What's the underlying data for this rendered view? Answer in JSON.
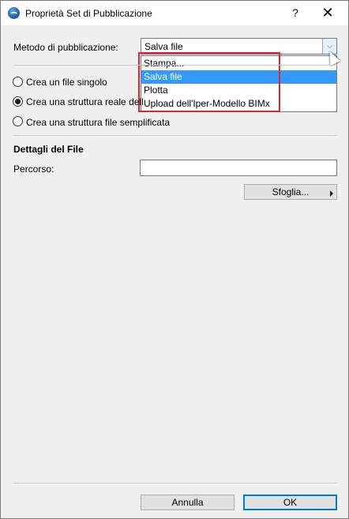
{
  "window": {
    "title": "Proprietà Set di Pubblicazione",
    "help_label": "?",
    "close_label": "✕"
  },
  "method": {
    "label": "Metodo di pubblicazione:",
    "selected": "Salva file",
    "arrow": "⌵",
    "options": [
      "Stampa...",
      "Salva file",
      "Plotta",
      "Upload dell'Iper-Modello BIMx"
    ],
    "selected_index": 1
  },
  "structure": {
    "options": [
      {
        "label": "Crea un file singolo",
        "checked": false
      },
      {
        "label": "Crea una struttura reale dell",
        "checked": true
      },
      {
        "label": "Crea una struttura file semplificata",
        "checked": false
      }
    ]
  },
  "details": {
    "heading": "Dettagli del File",
    "path_label": "Percorso:",
    "path_value": "",
    "browse_label": "Sfoglia..."
  },
  "footer": {
    "cancel_label": "Annulla",
    "ok_label": "OK"
  },
  "colors": {
    "highlight": "#e0262c",
    "selection": "#3399ff"
  }
}
